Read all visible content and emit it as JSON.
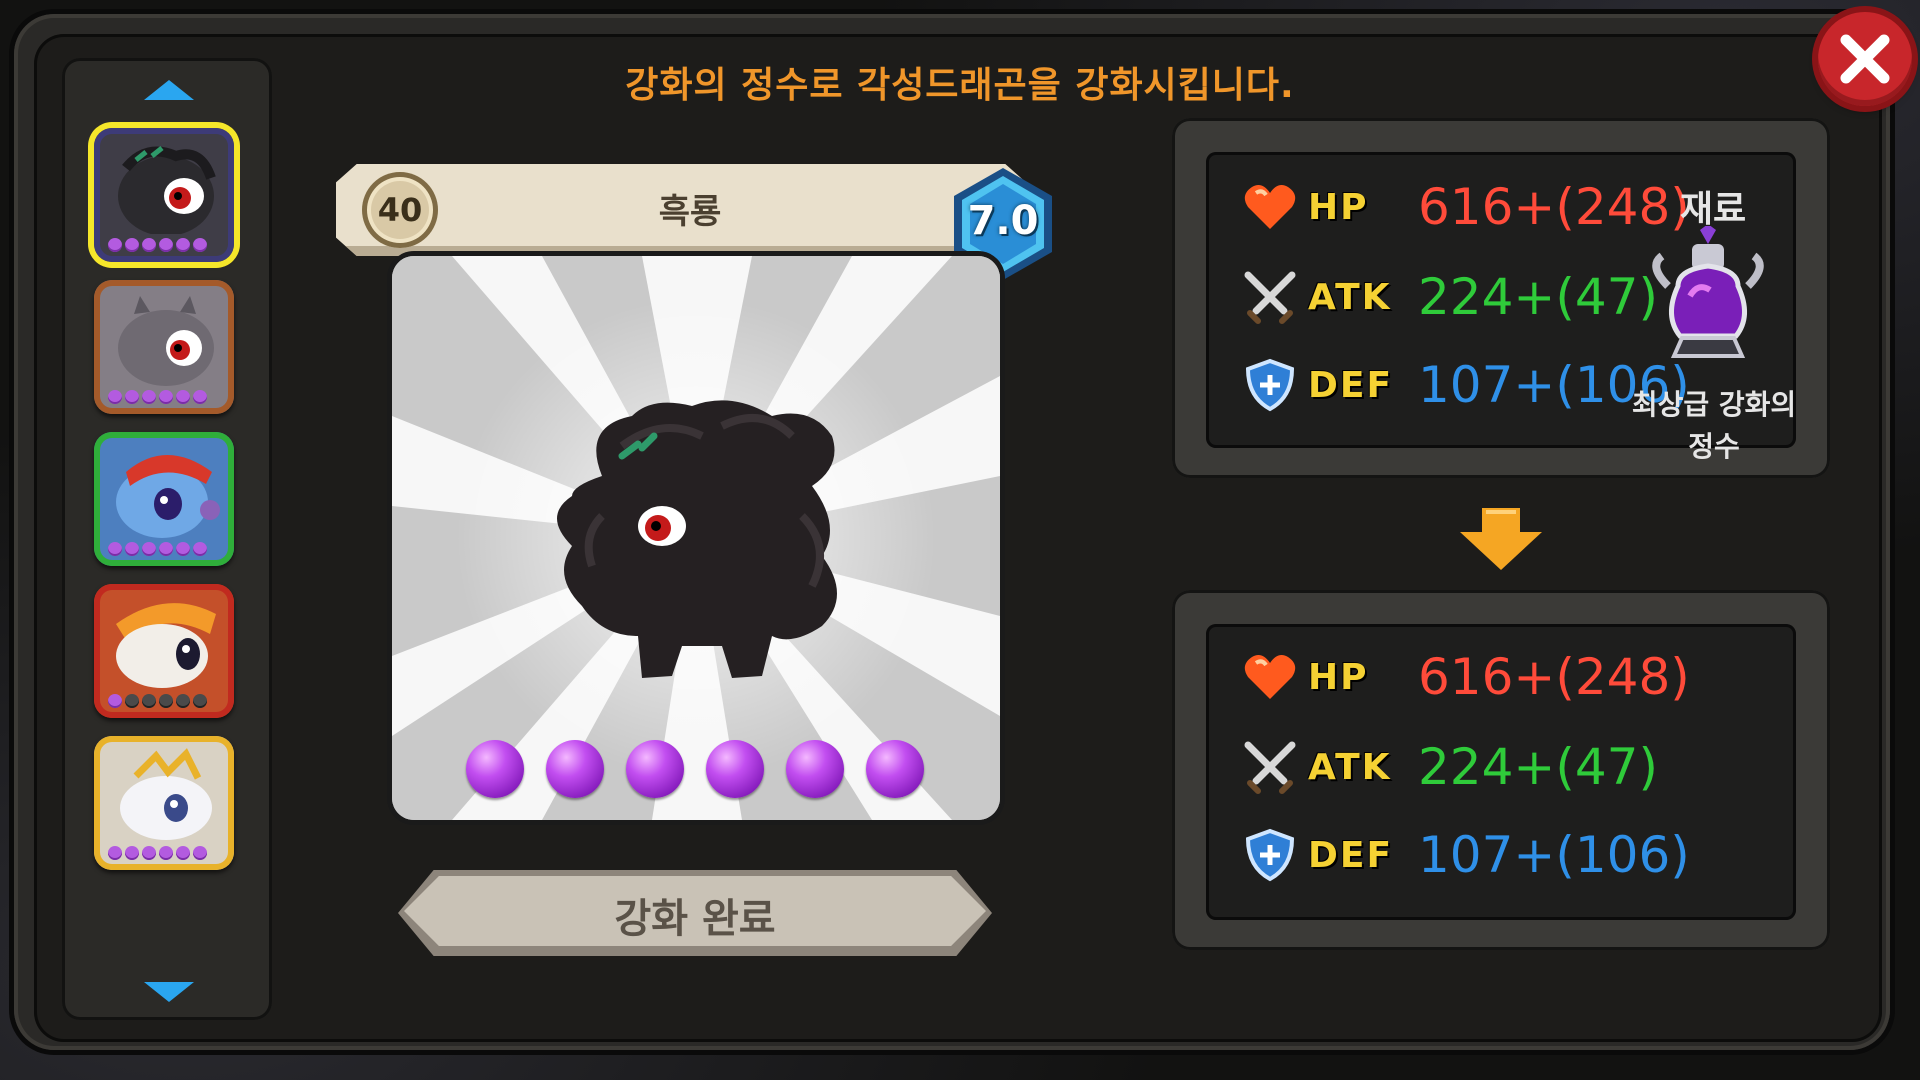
{
  "header": {
    "title": "강화의 정수로 각성드래곤을 강화시킵니다."
  },
  "dragon": {
    "level": "40",
    "name": "흑룡",
    "grade": "7.0",
    "orbs": 6
  },
  "action": {
    "complete_label": "강화 완료"
  },
  "stats_before": {
    "hp_label": "HP",
    "hp_value": "616+(248)",
    "atk_label": "ATK",
    "atk_value": "224+(47)",
    "def_label": "DEF",
    "def_value": "107+(106)"
  },
  "stats_after": {
    "hp_label": "HP",
    "hp_value": "616+(248)",
    "atk_label": "ATK",
    "atk_value": "224+(47)",
    "def_label": "DEF",
    "def_value": "107+(106)"
  },
  "material": {
    "label": "재료",
    "name_line1": "최상급 강화의",
    "name_line2": "정수"
  },
  "dragon_list": [
    {
      "icon": "black-dragon-avatar",
      "stars_filled": 6,
      "selected": true
    },
    {
      "icon": "gray-dragon-avatar",
      "stars_filled": 6
    },
    {
      "icon": "blue-dragon-avatar",
      "stars_filled": 6
    },
    {
      "icon": "white-fire-dragon-avatar",
      "stars_filled": 1
    },
    {
      "icon": "white-gold-dragon-avatar",
      "stars_filled": 6
    }
  ],
  "colors": {
    "title": "#f0962a",
    "hp": "#ff4b3a",
    "atk": "#2fcb3a",
    "def": "#2f90e8",
    "stat_label": "#f5d133"
  }
}
